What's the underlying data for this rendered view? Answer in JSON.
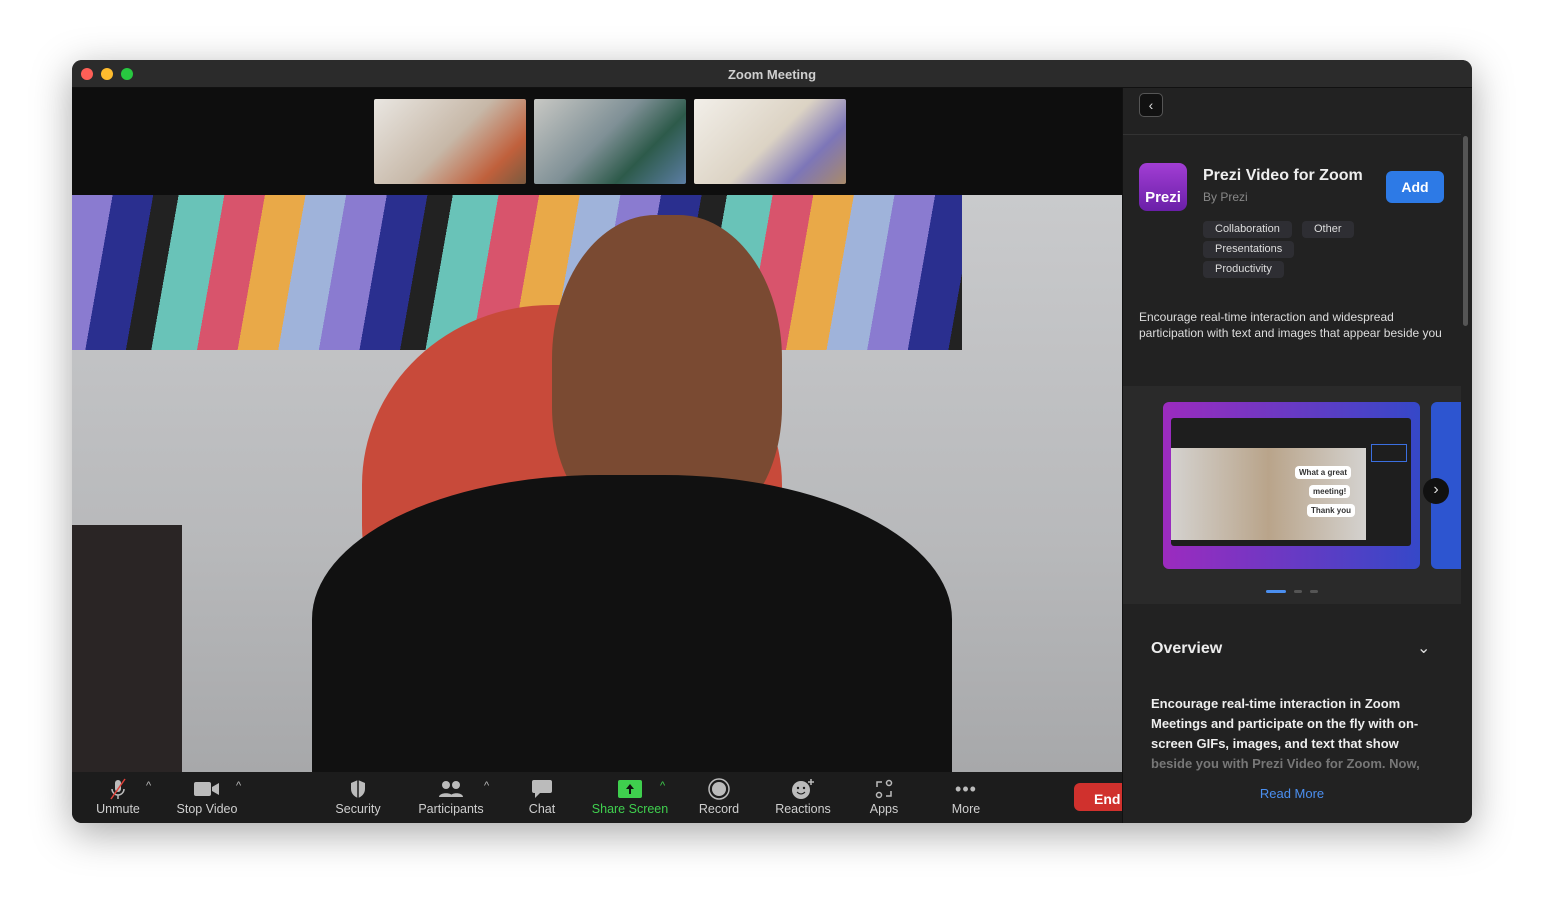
{
  "window": {
    "title": "Zoom Meeting"
  },
  "toolbar": {
    "unmute": "Unmute",
    "stop_video": "Stop Video",
    "security": "Security",
    "participants": "Participants",
    "chat": "Chat",
    "share_screen": "Share Screen",
    "record": "Record",
    "reactions": "Reactions",
    "apps": "Apps",
    "more": "More",
    "end": "End"
  },
  "panel": {
    "back_icon": "chevron-left-icon",
    "app_name": "Prezi Video for Zoom",
    "logo_text": "Prezi",
    "by": "By Prezi",
    "add": "Add",
    "tags": [
      "Collaboration",
      "Other",
      "Presentations",
      "Productivity"
    ],
    "description": "Encourage real-time interaction and widespread participation with text and images that appear beside you",
    "carousel": {
      "bubbles": [
        "What a great",
        "meeting!",
        "Thank you"
      ],
      "page": 1,
      "pages": 3
    },
    "overview_title": "Overview",
    "overview_text": "Encourage real-time interaction in Zoom Meetings and participate on the fly with on-screen GIFs, images, and text that show",
    "overview_fade": "beside you with Prezi Video for Zoom. Now,",
    "read_more": "Read More"
  },
  "colors": {
    "accent": "#2d7ae6",
    "share": "#3fcf4e",
    "end": "#d0312d"
  }
}
